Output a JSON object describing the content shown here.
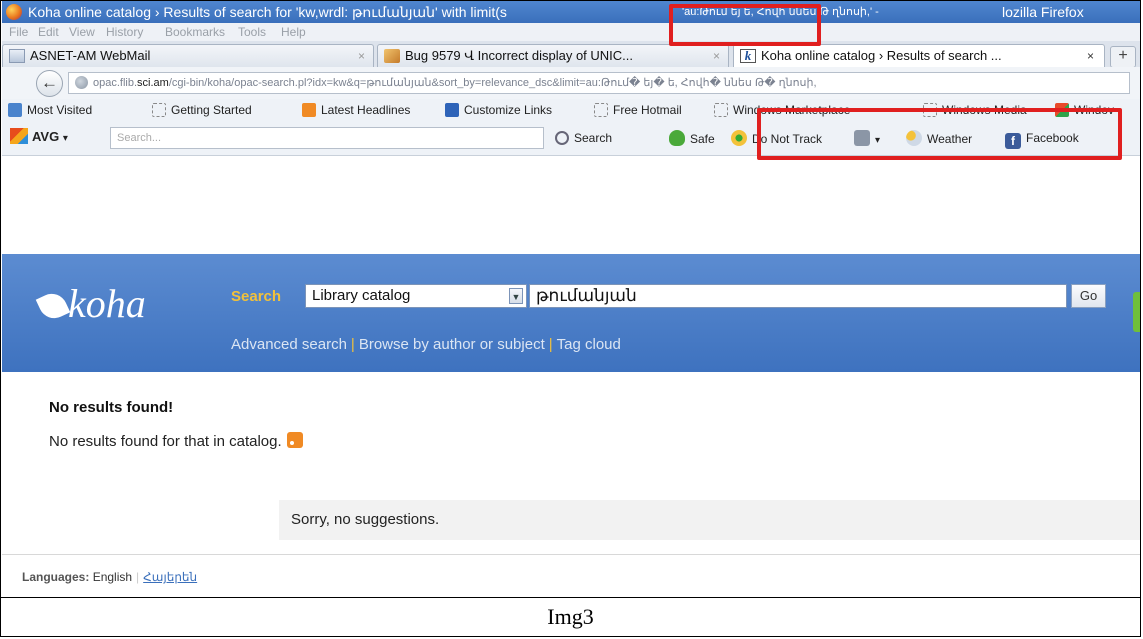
{
  "window": {
    "title": "Koha online catalog › Results of search for 'kw,wrdl: թումանյան' with limit(su: 'au:Թում եյ ե, Հովհ ննես Թ ղնոսի,' - Mozilla Firefox",
    "title_prefix": "Koha online catalog › Results of search for 'kw,wrdl: թումանյան' with limit(s",
    "title_garbled": "'au:Թում եյ ե, Հովհ ննես Թ ղնոսի,' -",
    "app_name": "lozilla Firefox"
  },
  "menu": [
    "File",
    "Edit",
    "View",
    "History",
    "Bookmarks",
    "Tools",
    "Help"
  ],
  "tabs": [
    {
      "label": "ASNET-AM WebMail",
      "close": "×",
      "active": false
    },
    {
      "label": "Bug 9579 Վ Incorrect display of UNIC...",
      "close": "×",
      "active": false
    },
    {
      "label": "Koha online catalog › Results of search ...",
      "close": "×",
      "active": true
    }
  ],
  "new_tab_label": "+",
  "nav": {
    "back_label": "←",
    "url_prefix": "opac.flib.",
    "url_host": "sci.am",
    "url_rest": "/cgi-bin/koha/opac-search.pl?idx=kw&q=թումանյան&sort_by=relevance_dsc&limit=au:Թում� եյ� ե, Հովհ� ննես Թ� ղնոսի,"
  },
  "bookmarks": [
    "Most Visited",
    "Getting Started",
    "Latest Headlines",
    "Customize Links",
    "Free Hotmail",
    "Windows Marketplace",
    "Windows Media",
    "Windov"
  ],
  "avg": {
    "logo": "AVG",
    "search_placeholder": "Search...",
    "search_button": "Search",
    "safe": "Safe",
    "do_not_track": "Do Not Track",
    "weather": "Weather",
    "facebook": "Facebook"
  },
  "koha": {
    "logo": "koha",
    "search_label": "Search",
    "catalog_select": "Library catalog",
    "query": "թումանյան",
    "go_label": "Go",
    "links": [
      "Advanced search",
      "Browse by author or subject",
      "Tag cloud"
    ],
    "link_sep": "|",
    "no_results_title": "No results found!",
    "no_results_text": "No results found for that in catalog.",
    "suggestions": "Sorry, no suggestions.",
    "languages_label": "Languages:",
    "lang_current": "English",
    "lang_alt": "Հայերեն"
  },
  "caption": "Img3",
  "colors": {
    "highlight": "#e01f1f",
    "koha_header": "#4a7cc6",
    "search_label": "#f1c13b"
  }
}
